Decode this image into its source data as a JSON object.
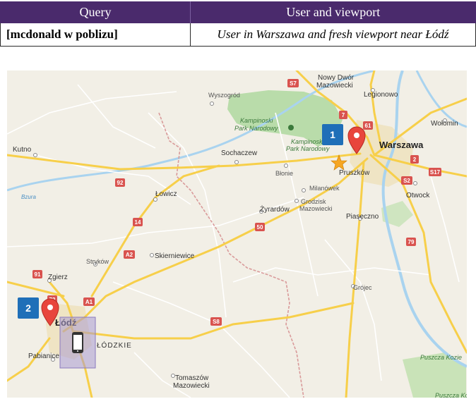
{
  "table": {
    "header": {
      "col1": "Query",
      "col2": "User and viewport"
    },
    "row": {
      "query": "[mcdonald w poblizu]",
      "user_viewport": "User in Warszawa and fresh viewport near Łódź"
    }
  },
  "map": {
    "cities": {
      "warszawa": "Warszawa",
      "lodz": "Łódź",
      "lodzkie": "ŁÓDZKIE",
      "nowy_dwor_1": "Nowy Dwór",
      "nowy_dwor_2": "Mazowiecki",
      "legionowo": "Legionowo",
      "wolomin": "Wołomin",
      "wyszogrod": "Wyszogród",
      "kutno": "Kutno",
      "sochaczew": "Sochaczew",
      "blonie": "Błonie",
      "pruszkow": "Pruszków",
      "otwock": "Otwock",
      "lowicz": "Łowicz",
      "milanowek": "Milanówek",
      "grodzisk_1": "Grodzisk",
      "grodzisk_2": "Mazowiecki",
      "zyrardow": "Żyrardów",
      "piaseczno": "Piaseczno",
      "skierniewice": "Skierniewice",
      "strykow": "Stryków",
      "zgierz": "Zgierz",
      "grojec": "Grójec",
      "pabianice": "Pabianice",
      "tomaszow_1": "Tomaszów",
      "tomaszow_2": "Mazowiecki",
      "kampinoski_1": "Kampinoski",
      "kampinoski_2": "Park Narodowy",
      "kampinoski_3": "Kampinoski",
      "kampinoski_4": "Park Narodowy",
      "puszcza_1": "Puszcza Kozie",
      "puszcza_2": "Puszcza Kozie",
      "bzura": "Bzura"
    },
    "roads": {
      "s7": "S7",
      "r7": "7",
      "r61": "61",
      "r2": "2",
      "s17": "S17",
      "s2": "S2",
      "r92": "92",
      "r14": "14",
      "r50": "50",
      "a2": "A2",
      "r79": "79",
      "r91": "91",
      "r72": "72",
      "a1": "A1",
      "s8": "S8"
    },
    "markers": {
      "marker1_label": "1",
      "marker2_label": "2"
    },
    "colors": {
      "header_bg": "#4a2a6c",
      "badge_blue": "#1f6fb8",
      "pin_red": "#e8453c",
      "viewport_fill": "#a99bd1",
      "park_green": "#b9dcaa",
      "road_yellow": "#f7cf4a"
    }
  }
}
